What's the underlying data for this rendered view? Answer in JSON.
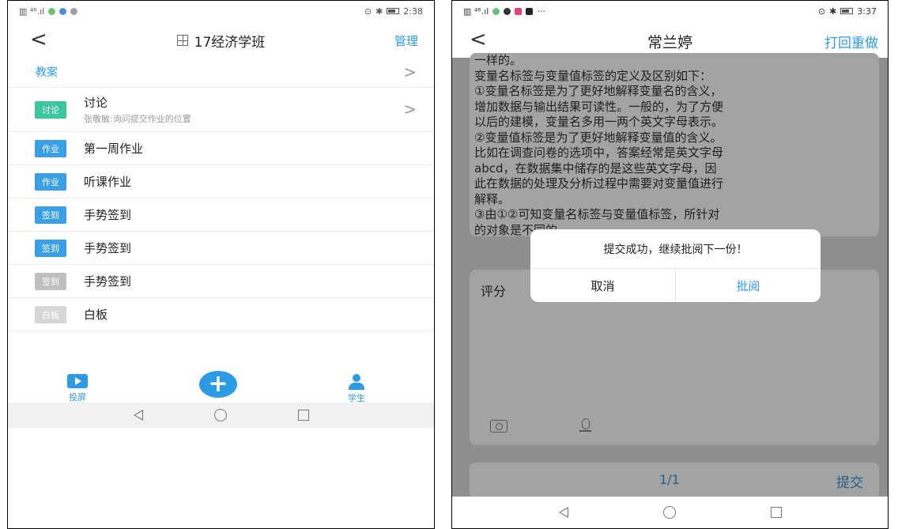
{
  "left": {
    "status": {
      "time": "2:38"
    },
    "nav": {
      "title": "17经济学班",
      "right": "管理"
    },
    "section": {
      "label": "教案"
    },
    "items": [
      {
        "tag": "讨论",
        "tag_color": "#3cc6a0",
        "label": "讨论",
        "sub": "张敬敏:询问提交作业的位置"
      },
      {
        "tag": "作业",
        "tag_color": "#3aa0e6",
        "label": "第一周作业"
      },
      {
        "tag": "作业",
        "tag_color": "#3aa0e6",
        "label": "听课作业"
      },
      {
        "tag": "签到",
        "tag_color": "#3aa0e6",
        "label": "手势签到"
      },
      {
        "tag": "签到",
        "tag_color": "#3aa0e6",
        "label": "手势签到"
      },
      {
        "tag": "签到",
        "tag_color": "#bfbfbf",
        "label": "手势签到"
      },
      {
        "tag": "白板",
        "tag_color": "#d6d6d6",
        "label": "白板"
      }
    ],
    "tabs": {
      "screen": "投屏",
      "student": "学生",
      "fab": "+"
    }
  },
  "right": {
    "status": {
      "time": "3:37"
    },
    "nav": {
      "title": "常兰婷",
      "right": "打回重做"
    },
    "content_lines": [
      "一样的。",
      "变量名标签与变量值标签的定义及区别如下：",
      "①变量名标签是为了更好地解释变量名的含义，",
      "增加数据与输出结果可读性。一般的，为了方便",
      "以后的建模，变量名多用一两个英文字母表示。",
      "②变量值标签是为了更好地解释变量值的含义。",
      "比如在调查问卷的选项中，答案经常是英文字母",
      "abcd，在数据集中储存的是这些英文字母，因",
      "此在数据的处理及分析过程中需要对变量值进行",
      "解释。",
      "③由①②可知变量名标签与变量值标签，所针对",
      "的对象是不同的。"
    ],
    "score_label": "评分",
    "pager": "1/1",
    "submit": "提交",
    "dialog": {
      "message": "提交成功，继续批阅下一份！",
      "cancel": "取消",
      "ok": "批阅"
    }
  }
}
